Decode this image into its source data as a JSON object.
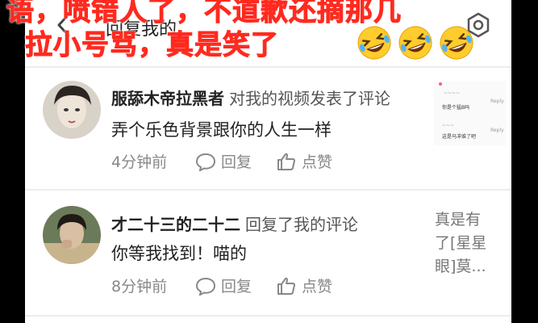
{
  "topbar": {
    "title": "回复我的"
  },
  "overlay": {
    "line1": "语，喷错人了，不道歉还摘那几",
    "line2": "拉小号骂，真是笑了"
  },
  "notifications": [
    {
      "username": "服舔木帝拉黑者",
      "action": "对我的视频发表了评论",
      "content": "弄个乐色背景跟你的人生一样",
      "time": "4分钟前",
      "reply_label": "回复",
      "like_label": "点赞"
    },
    {
      "username": "才二十三的二十二",
      "action": "回复了我的评论",
      "content": "你等我找到！喵的",
      "time": "8分钟前",
      "reply_label": "回复",
      "like_label": "点赞",
      "quote": "真是有了[星星眼]莫..."
    }
  ],
  "thumbnail": {
    "line1": "你是个猛B吗",
    "line2": "这是马冲谁了吧",
    "tag1": "Reply",
    "tag2": "Reply"
  },
  "colors": {
    "overlay_text": "#ff2a1f",
    "meta_text": "#888888",
    "background": "#ffffff"
  },
  "icons": [
    "back-arrow-icon",
    "settings-gear-icon",
    "rofl-emoji-icon",
    "comment-bubble-icon",
    "thumbs-up-icon"
  ]
}
